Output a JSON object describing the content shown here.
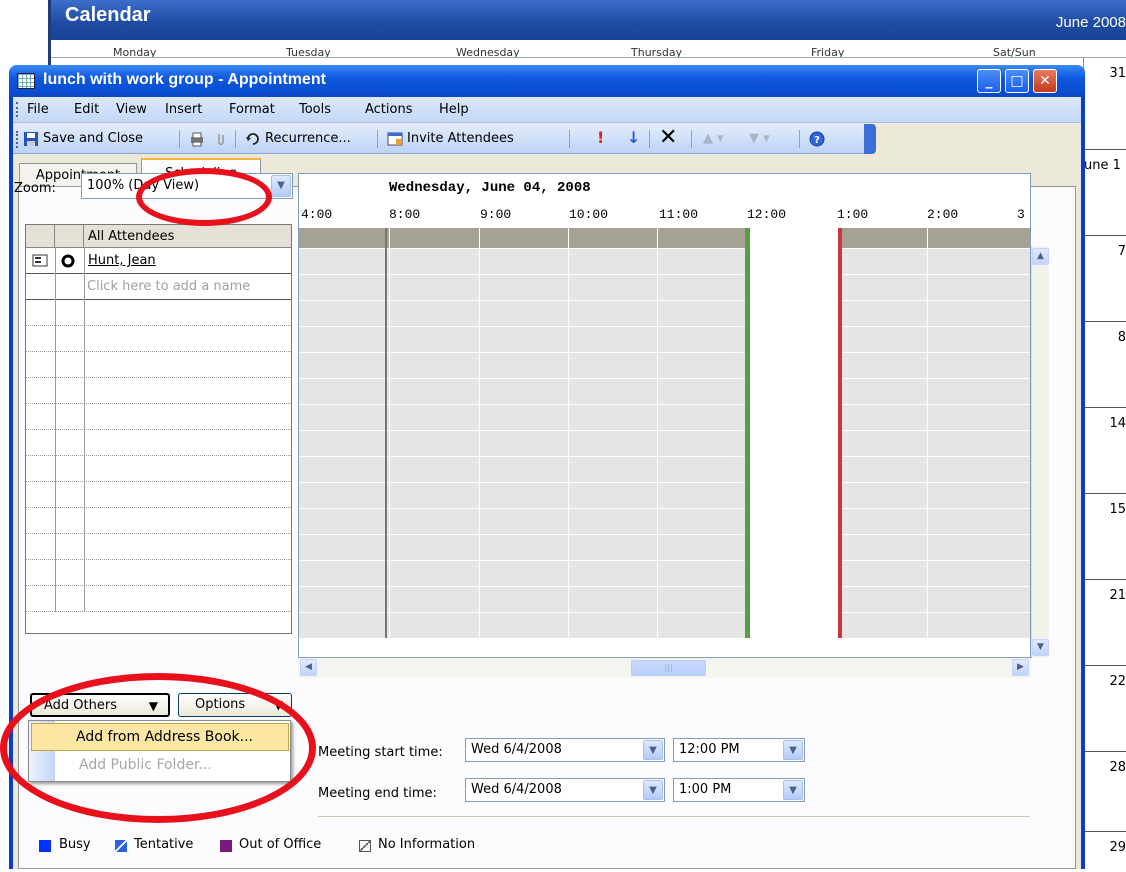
{
  "calendar": {
    "title": "Calendar",
    "month": "June 2008",
    "day_headers": [
      "Monday",
      "Tuesday",
      "Wednesday",
      "Thursday",
      "Friday",
      "Sat/Sun"
    ],
    "right_col_dates": [
      "31",
      "une 1",
      "7",
      "8",
      "14",
      "15",
      "21",
      "22",
      "28",
      "29"
    ]
  },
  "window": {
    "title": "lunch with work group - Appointment",
    "controls": {
      "minimize": "_",
      "maximize": "□",
      "close": "✕"
    }
  },
  "menu": [
    "File",
    "Edit",
    "View",
    "Insert",
    "Format",
    "Tools",
    "Actions",
    "Help"
  ],
  "toolbar": {
    "save_close": "Save and Close",
    "recurrence": "Recurrence...",
    "invite": "Invite Attendees"
  },
  "tabs": {
    "appointment": "Appointment",
    "scheduling": "Scheduling"
  },
  "zoom": {
    "label": "Zoom:",
    "value": "100% (Day View)"
  },
  "attendees": {
    "header": "All Attendees",
    "rows": [
      {
        "name": "Hunt, Jean"
      }
    ],
    "add_placeholder": "Click here to add a name"
  },
  "timeline": {
    "date": "Wednesday, June 04, 2008",
    "hours": [
      "4:00",
      "8:00",
      "9:00",
      "10:00",
      "11:00",
      "12:00",
      "1:00",
      "2:00",
      "3"
    ]
  },
  "buttons": {
    "add_others": "Add Others",
    "options": "Options"
  },
  "meeting": {
    "start_label": "Meeting start time:",
    "end_label": "Meeting end time:",
    "start_date": "Wed 6/4/2008",
    "start_time": "12:00 PM",
    "end_date": "Wed 6/4/2008",
    "end_time": "1:00 PM"
  },
  "popup_menu": {
    "item1": "Add from Address Book...",
    "item2": "Add Public Folder..."
  },
  "legend": [
    {
      "label": "Busy",
      "color": "#0033ff"
    },
    {
      "label": "Tentative",
      "color": "#2f5fe8"
    },
    {
      "label": "Out of Office",
      "color": "#7a1a7e"
    },
    {
      "label": "No Information",
      "color": "#ffffff"
    }
  ],
  "colors": {
    "title_bar": "#0a4fd2",
    "annotation": "#e8101a",
    "meeting_start": "#55a045",
    "meeting_end": "#c9363e"
  }
}
